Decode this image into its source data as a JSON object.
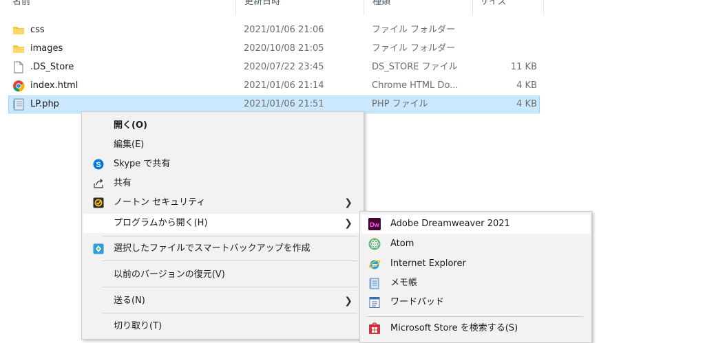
{
  "columns": {
    "name": "名前",
    "date": "更新日時",
    "type": "種類",
    "size": "サイズ"
  },
  "files": [
    {
      "name": "css",
      "date": "2021/01/06 21:06",
      "type": "ファイル フォルダー",
      "size": "",
      "icon": "folder-icon"
    },
    {
      "name": "images",
      "date": "2020/10/08 21:05",
      "type": "ファイル フォルダー",
      "size": "",
      "icon": "folder-icon"
    },
    {
      "name": ".DS_Store",
      "date": "2020/07/22 23:45",
      "type": "DS_STORE ファイル",
      "size": "11 KB",
      "icon": "file-icon"
    },
    {
      "name": "index.html",
      "date": "2021/01/06 21:14",
      "type": "Chrome HTML Do...",
      "size": "4 KB",
      "icon": "chrome-icon"
    },
    {
      "name": "LP.php",
      "date": "2021/01/06 21:51",
      "type": "PHP ファイル",
      "size": "4 KB",
      "icon": "php-file-icon",
      "selected": true
    }
  ],
  "context_menu": {
    "open": "開く(O)",
    "edit": "編集(E)",
    "skype_share": "Skype で共有",
    "share": "共有",
    "norton_security": "ノートン セキュリティ",
    "open_with": "プログラムから開く(H)",
    "smart_backup": "選択したファイルでスマートバックアップを作成",
    "restore_previous": "以前のバージョンの復元(V)",
    "send_to": "送る(N)",
    "cut": "切り取り(T)"
  },
  "open_with_menu": {
    "dreamweaver": "Adobe Dreamweaver 2021",
    "atom": "Atom",
    "internet_explorer": "Internet Explorer",
    "notepad": "メモ帳",
    "wordpad": "ワードパッド",
    "microsoft_store": "Microsoft Store を検索する(S)"
  },
  "colors": {
    "selection_bg": "#cce8ff",
    "selection_border": "#99d1ff",
    "menu_bg": "#f2f2f2",
    "folder": "#f8c53a",
    "dreamweaver": "#470137"
  }
}
